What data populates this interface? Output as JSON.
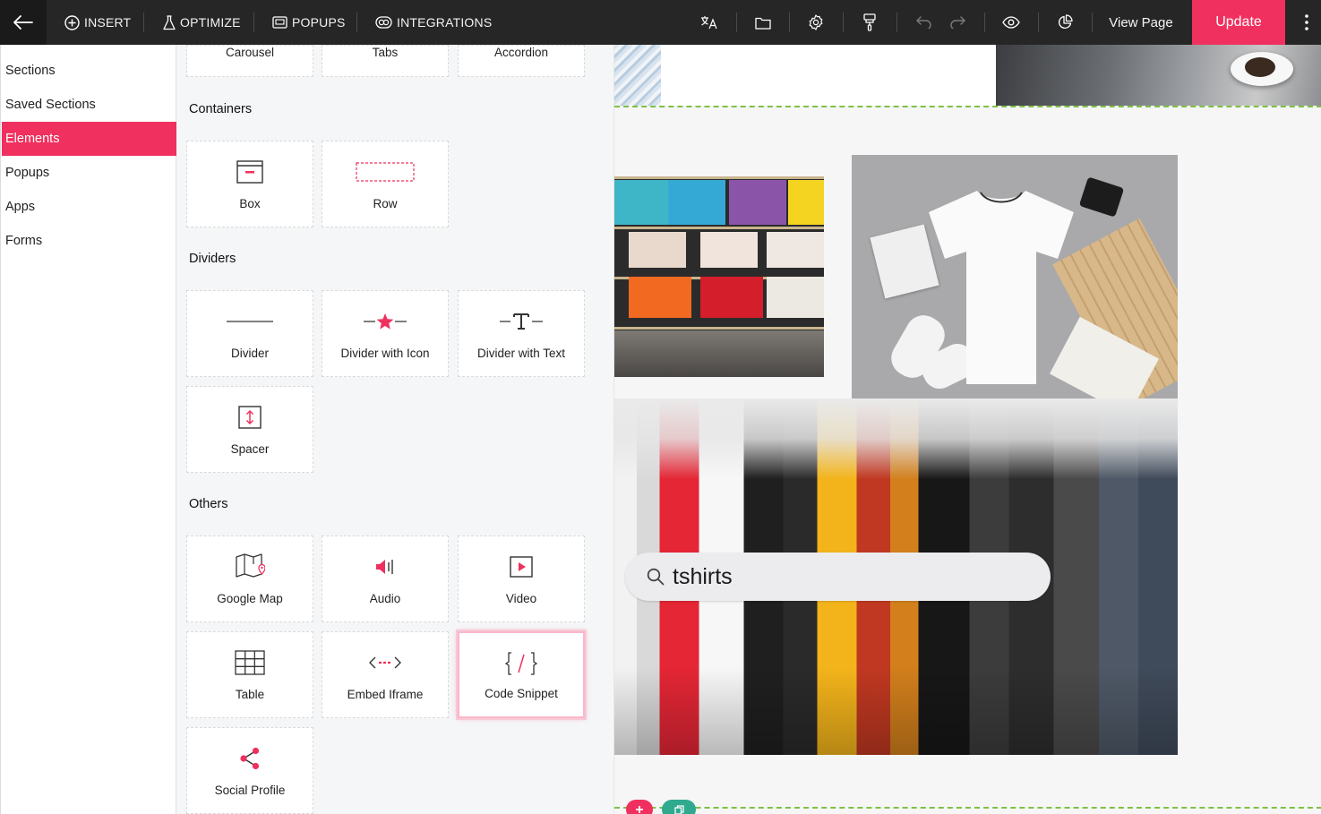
{
  "topbar": {
    "insert_label": "INSERT",
    "optimize_label": "OPTIMIZE",
    "popups_label": "POPUPS",
    "integrations_label": "INTEGRATIONS",
    "view_page_label": "View Page",
    "update_label": "Update",
    "accent_color": "#f0305e"
  },
  "leftnav": {
    "items": [
      {
        "label": "Sections"
      },
      {
        "label": "Saved Sections"
      },
      {
        "label": "Elements",
        "active": true
      },
      {
        "label": "Popups"
      },
      {
        "label": "Apps"
      },
      {
        "label": "Forms"
      }
    ]
  },
  "panel": {
    "top_row": [
      "Carousel",
      "Tabs",
      "Accordion"
    ],
    "containers": {
      "title": "Containers",
      "items": [
        "Box",
        "Row"
      ]
    },
    "dividers": {
      "title": "Dividers",
      "items": [
        "Divider",
        "Divider with Icon",
        "Divider with Text",
        "Spacer"
      ]
    },
    "others": {
      "title": "Others",
      "items": [
        "Google Map",
        "Audio",
        "Video",
        "Table",
        "Embed Iframe",
        "Code Snippet",
        "Social Profile"
      ]
    },
    "selected_item": "Code Snippet"
  },
  "canvas": {
    "search_text": "tshirts",
    "guide_color": "#7dc244"
  }
}
